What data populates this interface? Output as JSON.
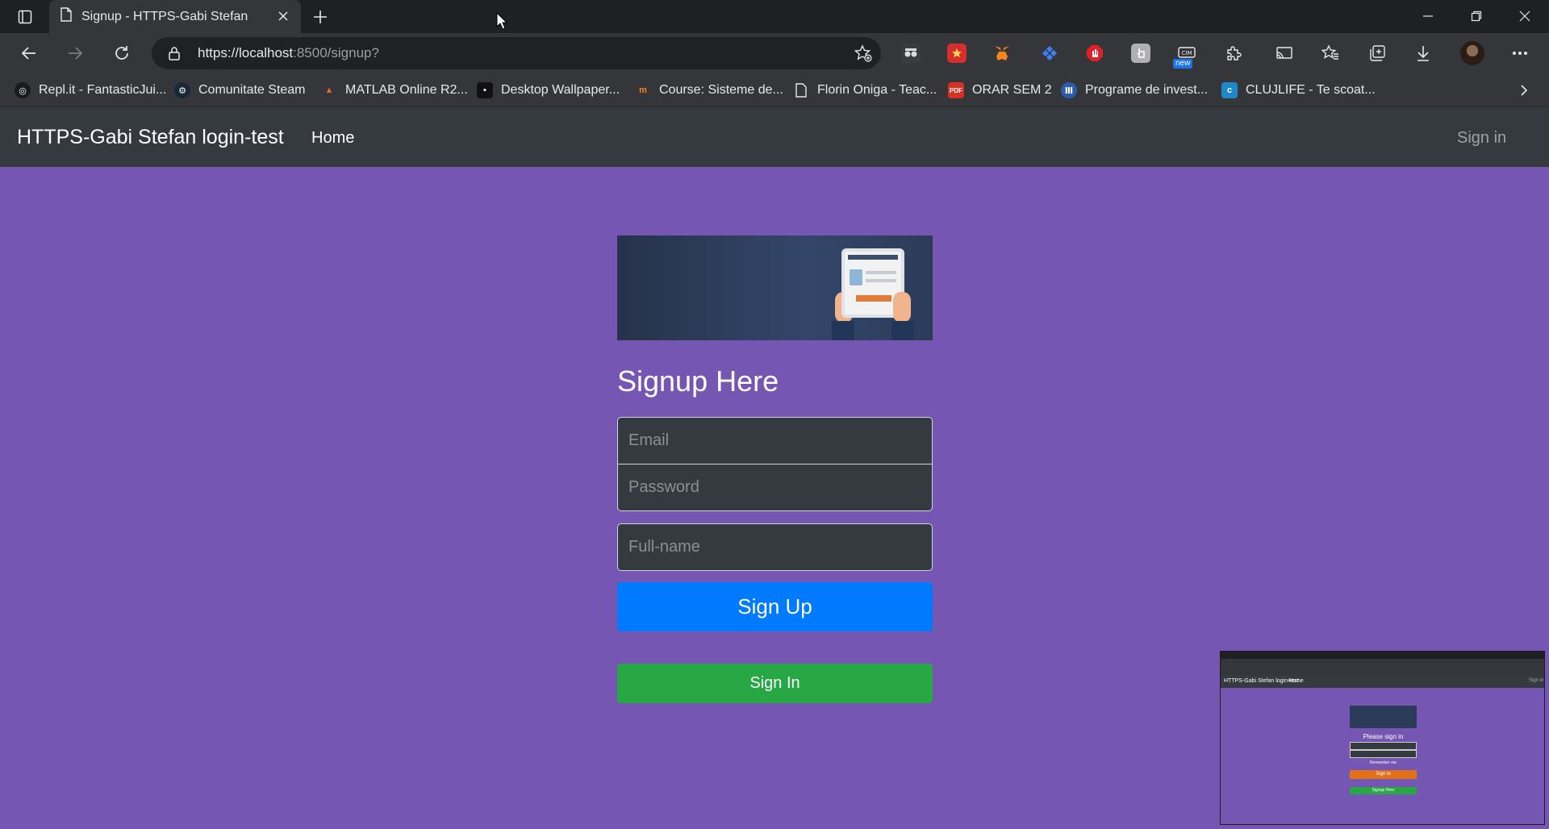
{
  "browser": {
    "tab_title": "Signup - HTTPS-Gabi Stefan",
    "url_host": "https://localhost",
    "url_rest": ":8500/signup?",
    "extension_badge": "new",
    "bookmarks": [
      {
        "label": "Repl.it - FantasticJui...",
        "icon": "replit-icon",
        "color": "#1b1b1b"
      },
      {
        "label": "Comunitate Steam",
        "icon": "steam-icon",
        "color": "#1b2838"
      },
      {
        "label": "MATLAB Online R2...",
        "icon": "matlab-icon",
        "color": "#e16737"
      },
      {
        "label": "Desktop Wallpaper...",
        "icon": "wallpaper-icon",
        "color": "#111111"
      },
      {
        "label": "Course: Sisteme de...",
        "icon": "moodle-icon",
        "color": "#f98012"
      },
      {
        "label": "Florin Oniga - Teac...",
        "icon": "page-icon",
        "color": "#35363a"
      },
      {
        "label": "ORAR SEM 2",
        "icon": "pdf-icon",
        "color": "#d93025"
      },
      {
        "label": "Programe de invest...",
        "icon": "allianz-icon",
        "color": "#2b5cab"
      },
      {
        "label": "CLUJLIFE - Te scoat...",
        "icon": "clujlife-icon",
        "color": "#1e88c8"
      }
    ]
  },
  "navbar": {
    "brand": "HTTPS-Gabi Stefan login-test",
    "home": "Home",
    "signin": "Sign in"
  },
  "form": {
    "title": "Signup Here",
    "email_placeholder": "Email",
    "password_placeholder": "Password",
    "fullname_placeholder": "Full-name",
    "signup_button": "Sign Up",
    "signin_button": "Sign In"
  },
  "thumbnail": {
    "brand": "HTTPS-Gabi Stefan login-test",
    "home": "Home",
    "signin": "Sign in",
    "title": "Please sign in",
    "remember": "Remember me",
    "signin_button": "Sign in",
    "signup_button": "Signup Here"
  },
  "colors": {
    "page_bg": "#7656b3",
    "navbar_bg": "#343a40",
    "primary": "#007bff",
    "success": "#28a745"
  }
}
